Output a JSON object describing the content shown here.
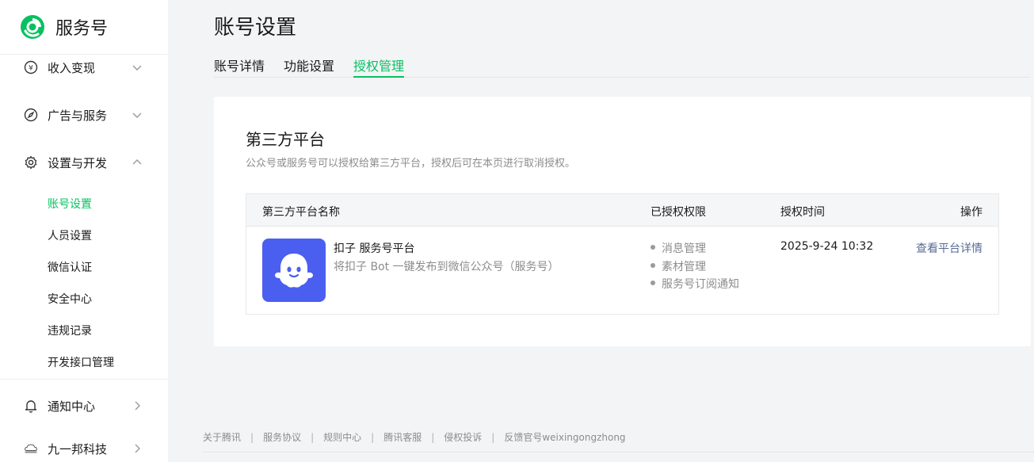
{
  "sidebar": {
    "logo_text": "服务号",
    "groups": [
      {
        "label": "收入变现",
        "icon": "yen-circle-icon"
      },
      {
        "label": "广告与服务",
        "icon": "compass-icon"
      },
      {
        "label": "设置与开发",
        "icon": "gear-icon"
      },
      {
        "label": "通知中心",
        "icon": "bell-icon"
      },
      {
        "label": "九一邦科技",
        "icon": "account-avatar-icon"
      }
    ],
    "sub_items": [
      "账号设置",
      "人员设置",
      "微信认证",
      "安全中心",
      "违规记录",
      "开发接口管理"
    ],
    "active_sub_item": "账号设置"
  },
  "main": {
    "title": "账号设置",
    "tabs": [
      {
        "label": "账号详情"
      },
      {
        "label": "功能设置"
      },
      {
        "label": "授权管理"
      }
    ],
    "active_tab": "授权管理",
    "card": {
      "title": "第三方平台",
      "description": "公众号或服务号可以授权给第三方平台，授权后可在本页进行取消授权。",
      "table": {
        "headers": {
          "name": "第三方平台名称",
          "permissions": "已授权权限",
          "time": "授权时间",
          "action": "操作"
        },
        "rows": [
          {
            "name": "扣子 服务号平台",
            "description": "将扣子 Bot 一键发布到微信公众号（服务号）",
            "permissions": [
              "消息管理",
              "素材管理",
              "服务号订阅通知"
            ],
            "time": "2025-9-24 10:32",
            "action": "查看平台详情",
            "icon": "ghost-mascot-icon"
          }
        ]
      }
    }
  },
  "footer": {
    "links": [
      "关于腾讯",
      "服务协议",
      "规则中心",
      "腾讯客服",
      "侵权投诉",
      "反馈官号weixingongzhong"
    ],
    "separator": "|"
  },
  "colors": {
    "accent": "#07c160",
    "link": "#576b95",
    "app_icon_bg": "#4a5ff0",
    "page_bg": "#f3f4f6"
  }
}
